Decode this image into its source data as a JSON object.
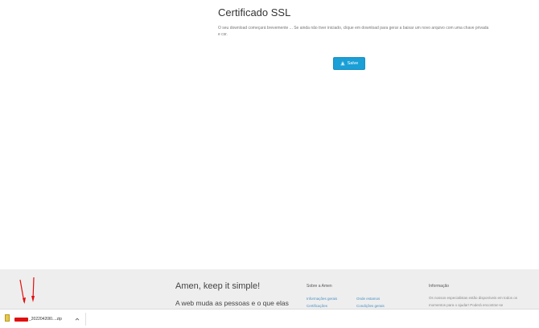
{
  "page": {
    "title": "Certificado SSL",
    "description": "O seu download começará brevemente ... Se ainda não tiver iniciado, clique em download para gerar a baixar um novo arquivo com uma chave privada e csr.",
    "save_label": "Salve"
  },
  "footer": {
    "tagline": "Amen, keep it simple!",
    "subtagline": "A web muda as pessoas e o que elas",
    "about": {
      "title": "Sobre a Amen",
      "links": [
        "Informações gerais",
        "Certificações",
        "Onde estamos",
        "Condições gerais"
      ]
    },
    "info": {
      "title": "Informação",
      "text": "Os nossos especialistas estão disponíveis em todos os momentos para o ajudar! Poderá encontrar-se"
    }
  },
  "download_bar": {
    "file_name": "_20220420l0....zip"
  },
  "colors": {
    "accent": "#1a9fd6",
    "annotation": "#e01010"
  },
  "icons": {
    "save": "download-icon",
    "file": "zip-file-icon",
    "chevron": "chevron-up-icon"
  }
}
